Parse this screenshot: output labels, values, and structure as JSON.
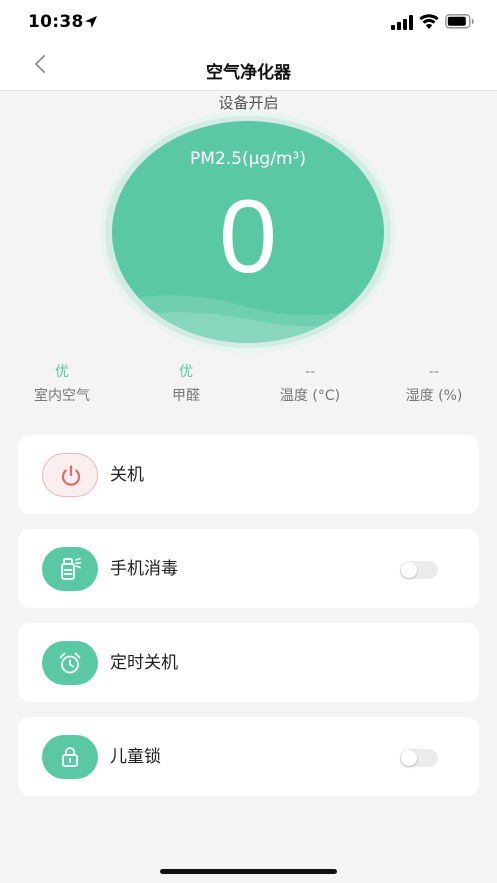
{
  "status_bar": {
    "time": "10:38"
  },
  "nav": {
    "title": "空气净化器"
  },
  "device": {
    "status": "设备开启"
  },
  "gauge": {
    "label": "PM2.5(µg/m³)",
    "value": "0"
  },
  "metrics": [
    {
      "value": "优",
      "label": "室内空气"
    },
    {
      "value": "优",
      "label": "甲醛"
    },
    {
      "value": "--",
      "label": "温度 (°C)"
    },
    {
      "value": "--",
      "label": "湿度 (%)"
    }
  ],
  "controls": [
    {
      "label": "关机",
      "icon": "power-icon"
    },
    {
      "label": "手机消毒",
      "icon": "phone-sanitizer-icon",
      "enabled": false
    },
    {
      "label": "定时关机",
      "icon": "alarm-clock-icon"
    },
    {
      "label": "儿童锁",
      "icon": "lock-icon",
      "enabled": false
    }
  ],
  "colors": {
    "accent": "#5ac8a5",
    "power_bg": "#fbeeee",
    "power_stroke": "#e06b6b"
  }
}
